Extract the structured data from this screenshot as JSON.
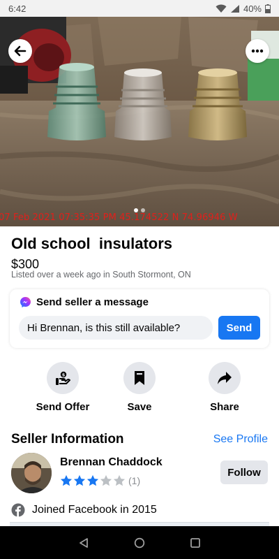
{
  "status_bar": {
    "time": "6:42",
    "battery": "40%"
  },
  "photo": {
    "timestamp_overlay": "07 Feb 2021 07:35:35 PM 45.174522 N 74.96946 W",
    "page_count": 2,
    "active_page": 1,
    "back_icon": "back-arrow-icon",
    "more_icon": "more-icon"
  },
  "listing": {
    "title": "Old school  insulators",
    "price": "$300",
    "listed": "Listed over a week ago in South Stormont, ON"
  },
  "message": {
    "header": "Send seller a message",
    "input_value": "Hi Brennan, is this still available?",
    "send_label": "Send"
  },
  "actions": [
    {
      "label": "Send Offer",
      "icon": "offer-icon"
    },
    {
      "label": "Save",
      "icon": "bookmark-icon"
    },
    {
      "label": "Share",
      "icon": "share-icon"
    }
  ],
  "seller": {
    "section_title": "Seller Information",
    "see_profile": "See Profile",
    "name": "Brennan Chaddock",
    "rating": 3,
    "rating_max": 5,
    "rating_count": "(1)",
    "follow_label": "Follow",
    "joined": "Joined Facebook in 2015"
  },
  "colors": {
    "accent": "#1877f2",
    "button_gray": "#e4e6eb",
    "star": "#1877f2",
    "star_empty": "#bcc0c4"
  }
}
